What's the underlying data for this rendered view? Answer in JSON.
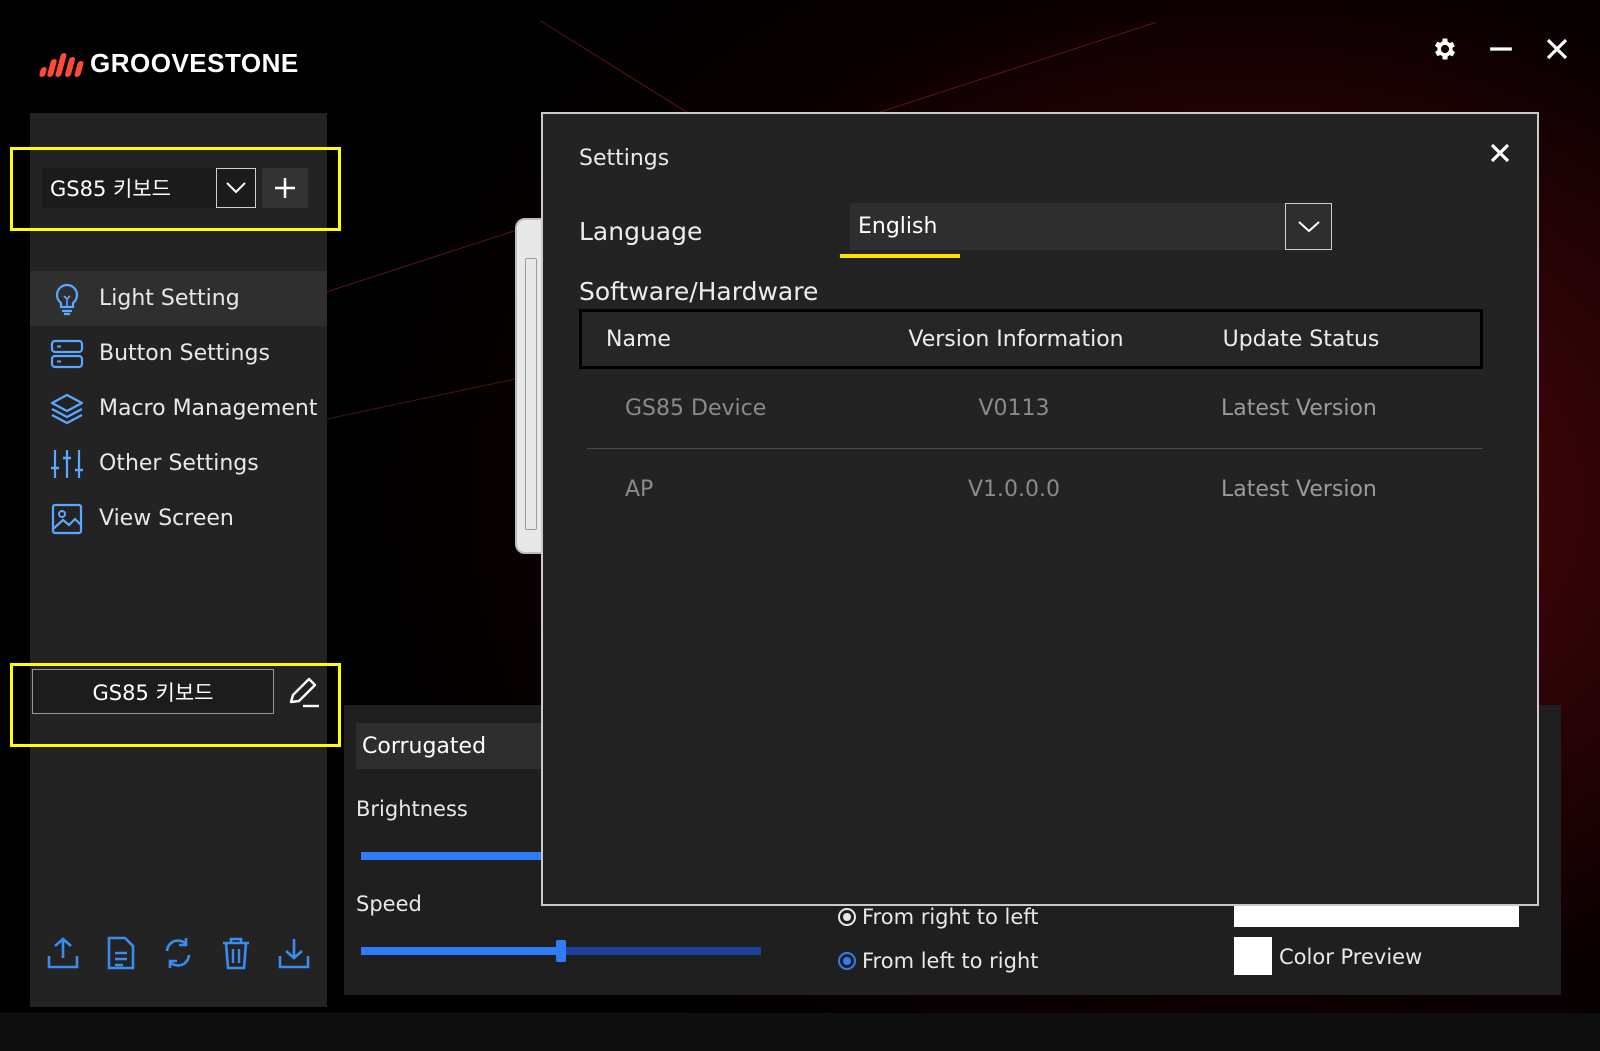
{
  "app": {
    "brand": "GROOVESTONE",
    "accent_color": "#ff4a3a",
    "window_controls": [
      "gear-icon",
      "minimize-icon",
      "close-icon"
    ]
  },
  "sidebar": {
    "device_select": {
      "value": "GS85 키보드",
      "icon": "chevron-down-icon"
    },
    "add_icon": "plus-icon",
    "nav_items": [
      {
        "label": "Light Setting",
        "icon": "lightbulb-icon",
        "active": true
      },
      {
        "label": "Button Settings",
        "icon": "buttons-icon",
        "active": false
      },
      {
        "label": "Macro Management",
        "icon": "layers-icon",
        "active": false
      },
      {
        "label": "Other Settings",
        "icon": "sliders-icon",
        "active": false
      },
      {
        "label": "View Screen",
        "icon": "image-icon",
        "active": false
      }
    ],
    "profile_name": "GS85 키보드",
    "toolbar_icons": [
      "export-icon",
      "document-icon",
      "refresh-icon",
      "trash-icon",
      "import-icon"
    ]
  },
  "light_panel": {
    "effect": "Corrugated",
    "brightness_label": "Brightness",
    "speed_label": "Speed",
    "speed_value": 0.5,
    "direction_options": [
      {
        "label": "From right to left",
        "selected": false
      },
      {
        "label": "From left to right",
        "selected": true
      }
    ],
    "color_preview_label": "Color Preview"
  },
  "settings_dialog": {
    "title": "Settings",
    "language_label": "Language",
    "language_value": "English",
    "section_title": "Software/Hardware",
    "columns": [
      "Name",
      "Version Information",
      "Update Status"
    ],
    "rows": [
      {
        "name": "GS85 Device",
        "version": "V0113",
        "status": "Latest Version"
      },
      {
        "name": "AP",
        "version": "V1.0.0.0",
        "status": "Latest Version"
      }
    ],
    "highlight_color": "#ffff00",
    "slider_color": "#2f7cf6"
  }
}
